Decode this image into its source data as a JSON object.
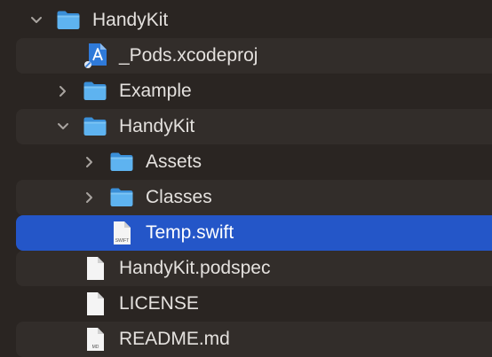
{
  "window": {
    "title": "HandyKit"
  },
  "tree": {
    "items": [
      {
        "name": "tree-item-handykit-root",
        "label": "HandyKit",
        "kind": "folder",
        "icon": "folder-icon",
        "depth": 0,
        "expanded": true,
        "has_children": true,
        "selected": false
      },
      {
        "name": "tree-item-pods-xcodeproj",
        "label": "_Pods.xcodeproj",
        "kind": "xcodeproj",
        "icon": "xcodeproj-icon",
        "depth": 1,
        "has_children": false,
        "selected": false
      },
      {
        "name": "tree-item-example",
        "label": "Example",
        "kind": "folder",
        "icon": "folder-icon",
        "depth": 1,
        "expanded": false,
        "has_children": true,
        "selected": false
      },
      {
        "name": "tree-item-handykit",
        "label": "HandyKit",
        "kind": "folder",
        "icon": "folder-icon",
        "depth": 1,
        "expanded": true,
        "has_children": true,
        "selected": false
      },
      {
        "name": "tree-item-assets",
        "label": "Assets",
        "kind": "folder",
        "icon": "folder-icon",
        "depth": 2,
        "expanded": false,
        "has_children": true,
        "selected": false
      },
      {
        "name": "tree-item-classes",
        "label": "Classes",
        "kind": "folder",
        "icon": "folder-icon",
        "depth": 2,
        "expanded": false,
        "has_children": true,
        "selected": false
      },
      {
        "name": "tree-item-temp-swift",
        "label": "Temp.swift",
        "kind": "file",
        "icon": "swift-file-icon",
        "file_tag": "SWIFT",
        "depth": 2,
        "has_children": false,
        "selected": true
      },
      {
        "name": "tree-item-handykit-podspec",
        "label": "HandyKit.podspec",
        "kind": "file",
        "icon": "document-icon",
        "depth": 1,
        "has_children": false,
        "selected": false
      },
      {
        "name": "tree-item-license",
        "label": "LICENSE",
        "kind": "file",
        "icon": "document-icon",
        "depth": 1,
        "has_children": false,
        "selected": false
      },
      {
        "name": "tree-item-readme",
        "label": "README.md",
        "kind": "file",
        "icon": "markdown-file-icon",
        "file_tag": "MD",
        "depth": 1,
        "has_children": false,
        "selected": false
      }
    ]
  },
  "colors": {
    "background": "#2a2522",
    "alternate_row": "#322d2a",
    "selection": "#2456c8",
    "folder_blue": "#5eb3f0",
    "text": "#e4e1de"
  }
}
